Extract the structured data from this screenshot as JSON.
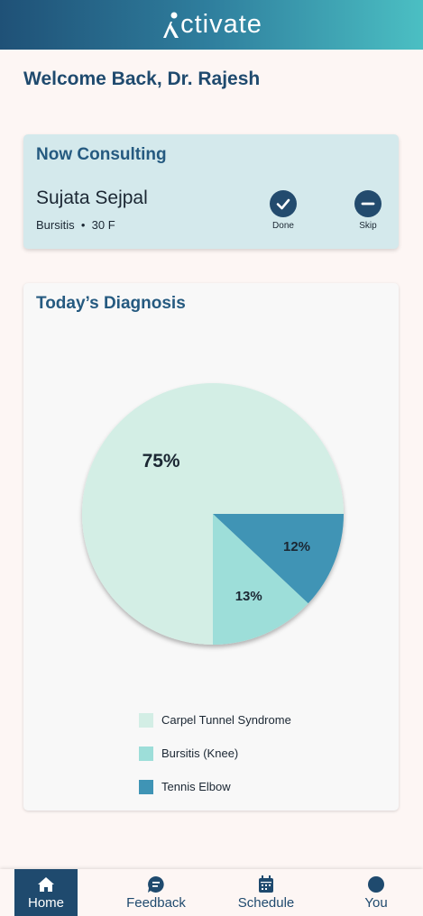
{
  "app": {
    "logo_text": "ctivate"
  },
  "welcome": "Welcome Back, Dr. Rajesh",
  "consulting": {
    "title": "Now Consulting",
    "patient_name": "Sujata Sejpal",
    "condition": "Bursitis",
    "age_gender": "30 F",
    "done_label": "Done",
    "skip_label": "Skip"
  },
  "diagnosis": {
    "title": "Today’s Diagnosis"
  },
  "chart_data": {
    "type": "pie",
    "categories": [
      "Carpel Tunnel Syndrome",
      "Bursitis (Knee)",
      "Tennis Elbow"
    ],
    "values": [
      75,
      13,
      12
    ],
    "labels": [
      "75%",
      "13%",
      "12%"
    ],
    "colors": [
      "#d3eee5",
      "#9dded9",
      "#3f94b5"
    ],
    "legend_position": "bottom"
  },
  "nav": {
    "items": [
      {
        "label": "Home",
        "icon": "home-icon",
        "active": true
      },
      {
        "label": "Feedback",
        "icon": "feedback-icon",
        "active": false
      },
      {
        "label": "Schedule",
        "icon": "calendar-icon",
        "active": false
      },
      {
        "label": "You",
        "icon": "profile-icon",
        "active": false
      }
    ]
  }
}
